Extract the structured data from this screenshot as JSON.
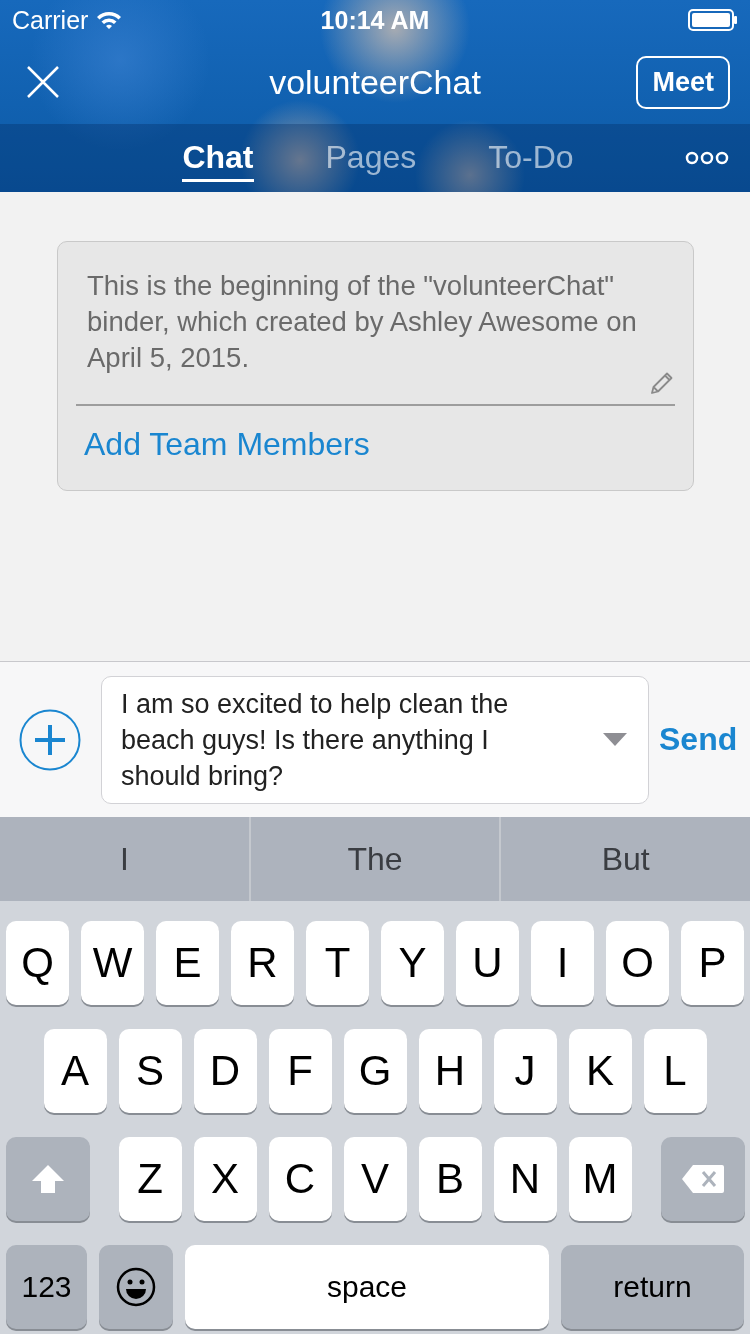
{
  "status_bar": {
    "carrier": "Carrier",
    "time": "10:14 AM"
  },
  "header": {
    "title": "volunteerChat",
    "meet_button": "Meet"
  },
  "tabs": [
    {
      "label": "Chat",
      "selected": true
    },
    {
      "label": "Pages",
      "selected": false
    },
    {
      "label": "To-Do",
      "selected": false
    }
  ],
  "intro_card": {
    "text": "This is the beginning of the \"volunteerChat\" binder, which created by Ashley Awesome on April 5, 2015.",
    "link": "Add Team Members"
  },
  "composer": {
    "value": "I am so excited to help clean the beach guys! Is there anything I should bring?",
    "send_button": "Send"
  },
  "suggestions": [
    "I",
    "The",
    "But"
  ],
  "keyboard": {
    "rows": [
      {
        "keys": [
          {
            "kind": "letter",
            "label": "Q"
          },
          {
            "kind": "letter",
            "label": "W"
          },
          {
            "kind": "letter",
            "label": "E"
          },
          {
            "kind": "letter",
            "label": "R"
          },
          {
            "kind": "letter",
            "label": "T"
          },
          {
            "kind": "letter",
            "label": "Y"
          },
          {
            "kind": "letter",
            "label": "U"
          },
          {
            "kind": "letter",
            "label": "I"
          },
          {
            "kind": "letter",
            "label": "O"
          },
          {
            "kind": "letter",
            "label": "P"
          }
        ]
      },
      {
        "keys": [
          {
            "kind": "letter",
            "label": "A"
          },
          {
            "kind": "letter",
            "label": "S"
          },
          {
            "kind": "letter",
            "label": "D"
          },
          {
            "kind": "letter",
            "label": "F"
          },
          {
            "kind": "letter",
            "label": "G"
          },
          {
            "kind": "letter",
            "label": "H"
          },
          {
            "kind": "letter",
            "label": "J"
          },
          {
            "kind": "letter",
            "label": "K"
          },
          {
            "kind": "letter",
            "label": "L"
          }
        ]
      },
      {
        "keys": [
          {
            "kind": "shift"
          },
          {
            "kind": "letter",
            "label": "Z"
          },
          {
            "kind": "letter",
            "label": "X"
          },
          {
            "kind": "letter",
            "label": "C"
          },
          {
            "kind": "letter",
            "label": "V"
          },
          {
            "kind": "letter",
            "label": "B"
          },
          {
            "kind": "letter",
            "label": "N"
          },
          {
            "kind": "letter",
            "label": "M"
          },
          {
            "kind": "delete"
          }
        ]
      },
      {
        "keys": [
          {
            "kind": "numbers",
            "label": "123"
          },
          {
            "kind": "emoji"
          },
          {
            "kind": "space",
            "label": "space"
          },
          {
            "kind": "return",
            "label": "return"
          }
        ]
      }
    ]
  }
}
